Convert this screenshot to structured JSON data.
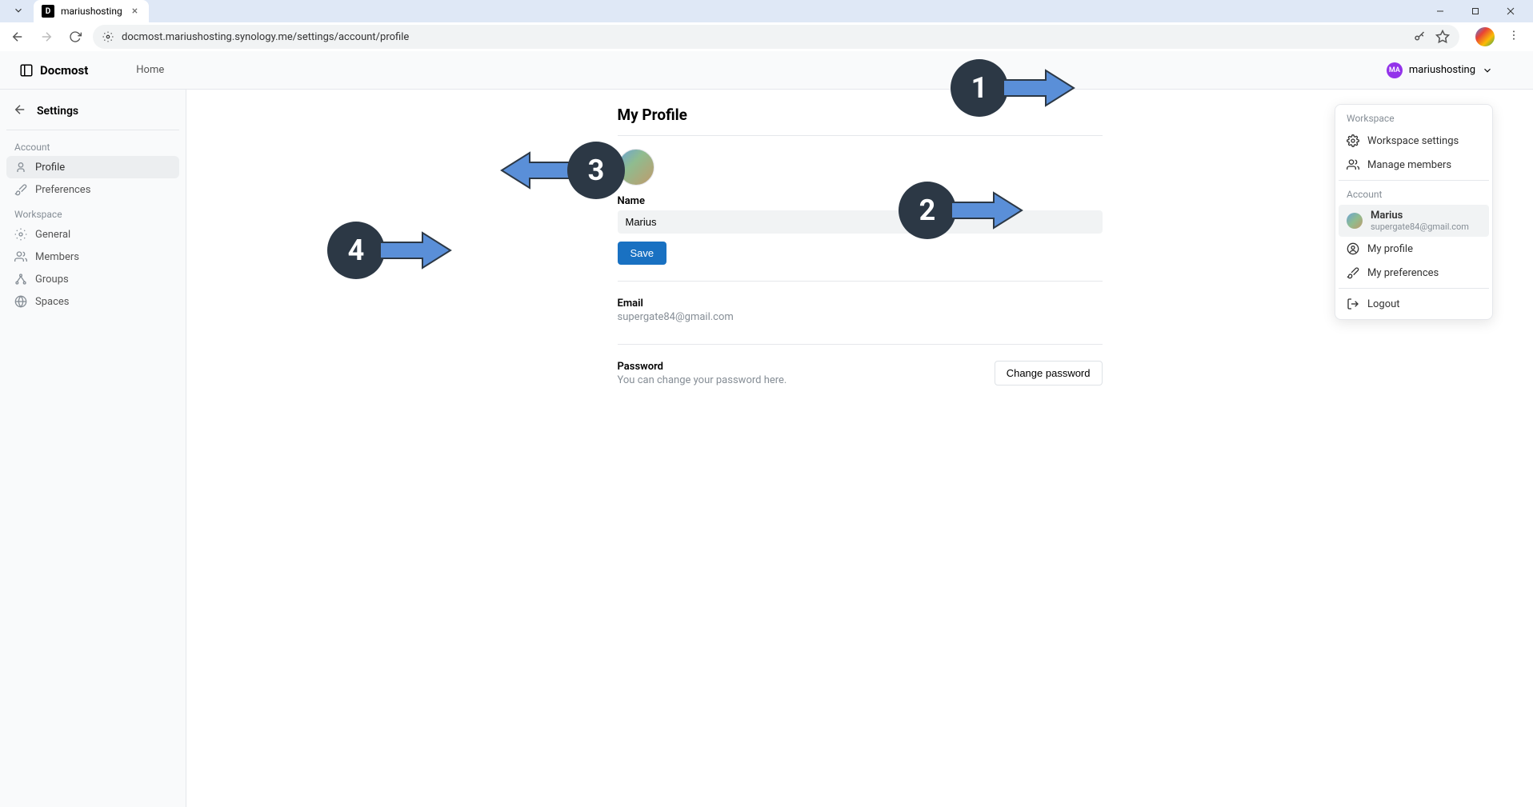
{
  "browser": {
    "tab_title": "mariushosting",
    "url": "docmost.mariushosting.synology.me/settings/account/profile"
  },
  "header": {
    "app_name": "Docmost",
    "nav_home": "Home",
    "user_badge": "MA",
    "user_display": "mariushosting"
  },
  "dropdown": {
    "section_workspace": "Workspace",
    "workspace_settings": "Workspace settings",
    "manage_members": "Manage members",
    "section_account": "Account",
    "user_name": "Marius",
    "user_email": "supergate84@gmail.com",
    "my_profile": "My profile",
    "my_preferences": "My preferences",
    "logout": "Logout"
  },
  "sidebar": {
    "title": "Settings",
    "section_account": "Account",
    "profile": "Profile",
    "preferences": "Preferences",
    "section_workspace": "Workspace",
    "general": "General",
    "members": "Members",
    "groups": "Groups",
    "spaces": "Spaces"
  },
  "profile": {
    "title": "My Profile",
    "name_label": "Name",
    "name_value": "Marius",
    "save_label": "Save",
    "email_label": "Email",
    "email_value": "supergate84@gmail.com",
    "password_label": "Password",
    "password_desc": "You can change your password here.",
    "change_password": "Change password"
  },
  "annotations": {
    "n1": "1",
    "n2": "2",
    "n3": "3",
    "n4": "4"
  }
}
